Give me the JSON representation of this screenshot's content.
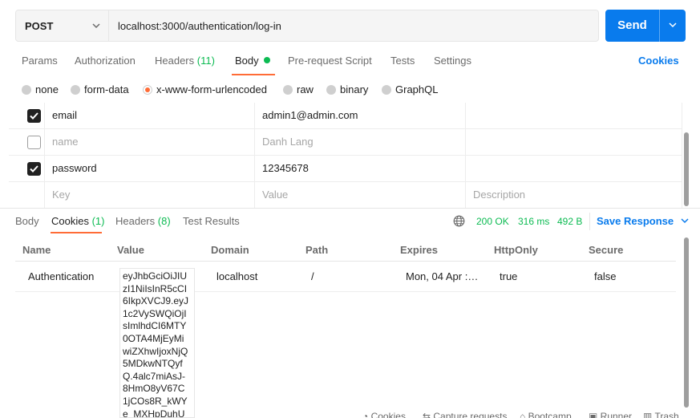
{
  "request": {
    "method": "POST",
    "url": "localhost:3000/authentication/log-in",
    "send_label": "Send"
  },
  "request_tabs": {
    "params": "Params",
    "authorization": "Authorization",
    "headers": "Headers",
    "headers_count": "(11)",
    "body": "Body",
    "pre_request": "Pre-request Script",
    "tests": "Tests",
    "settings": "Settings",
    "cookies": "Cookies"
  },
  "body_types": {
    "none": "none",
    "form_data": "form-data",
    "urlencoded": "x-www-form-urlencoded",
    "raw": "raw",
    "binary": "binary",
    "graphql": "GraphQL",
    "selected": "x-www-form-urlencoded"
  },
  "params": {
    "rows": [
      {
        "checked": true,
        "key": "email",
        "value": "admin1@admin.com"
      },
      {
        "checked": false,
        "key": "name",
        "value": "Danh Lang"
      },
      {
        "checked": true,
        "key": "password",
        "value": "12345678"
      }
    ],
    "placeholder": {
      "key": "Key",
      "value": "Value",
      "description": "Description"
    }
  },
  "response_tabs": {
    "body": "Body",
    "cookies": "Cookies",
    "cookies_count": "(1)",
    "headers": "Headers",
    "headers_count": "(8)",
    "test_results": "Test Results"
  },
  "response_meta": {
    "status": "200 OK",
    "time": "316 ms",
    "size": "492 B",
    "save_response": "Save Response"
  },
  "cookies_table": {
    "headers": {
      "name": "Name",
      "value": "Value",
      "domain": "Domain",
      "path": "Path",
      "expires": "Expires",
      "httponly": "HttpOnly",
      "secure": "Secure"
    },
    "row": {
      "name": "Authentication",
      "value_lines": [
        "eyJhbGciOiJIU",
        "zI1NiIsInR5cCI",
        "6IkpXVCJ9.eyJ",
        "1c2VySWQiOjI",
        "sImlhdCI6MTY",
        "0OTA4MjEyMi",
        "wiZXhwIjoxNjQ",
        "5MDkwNTQyf",
        "Q.4alc7miAsJ-",
        "8HmO8yV67C",
        "1jCOs8R_kWY",
        "e_MXHpDuhU"
      ],
      "domain": "localhost",
      "path": "/",
      "expires": "Mon, 04 Apr :…",
      "httponly": "true",
      "secure": "false"
    }
  },
  "footer": {
    "cookies": "Cookies",
    "capture": "Capture requests",
    "bootcamp": "Bootcamp",
    "runner": "Runner",
    "trash": "Trash"
  },
  "colors": {
    "accent_blue": "#097bed",
    "orange": "#ff6c37",
    "green": "#0cbb52"
  }
}
